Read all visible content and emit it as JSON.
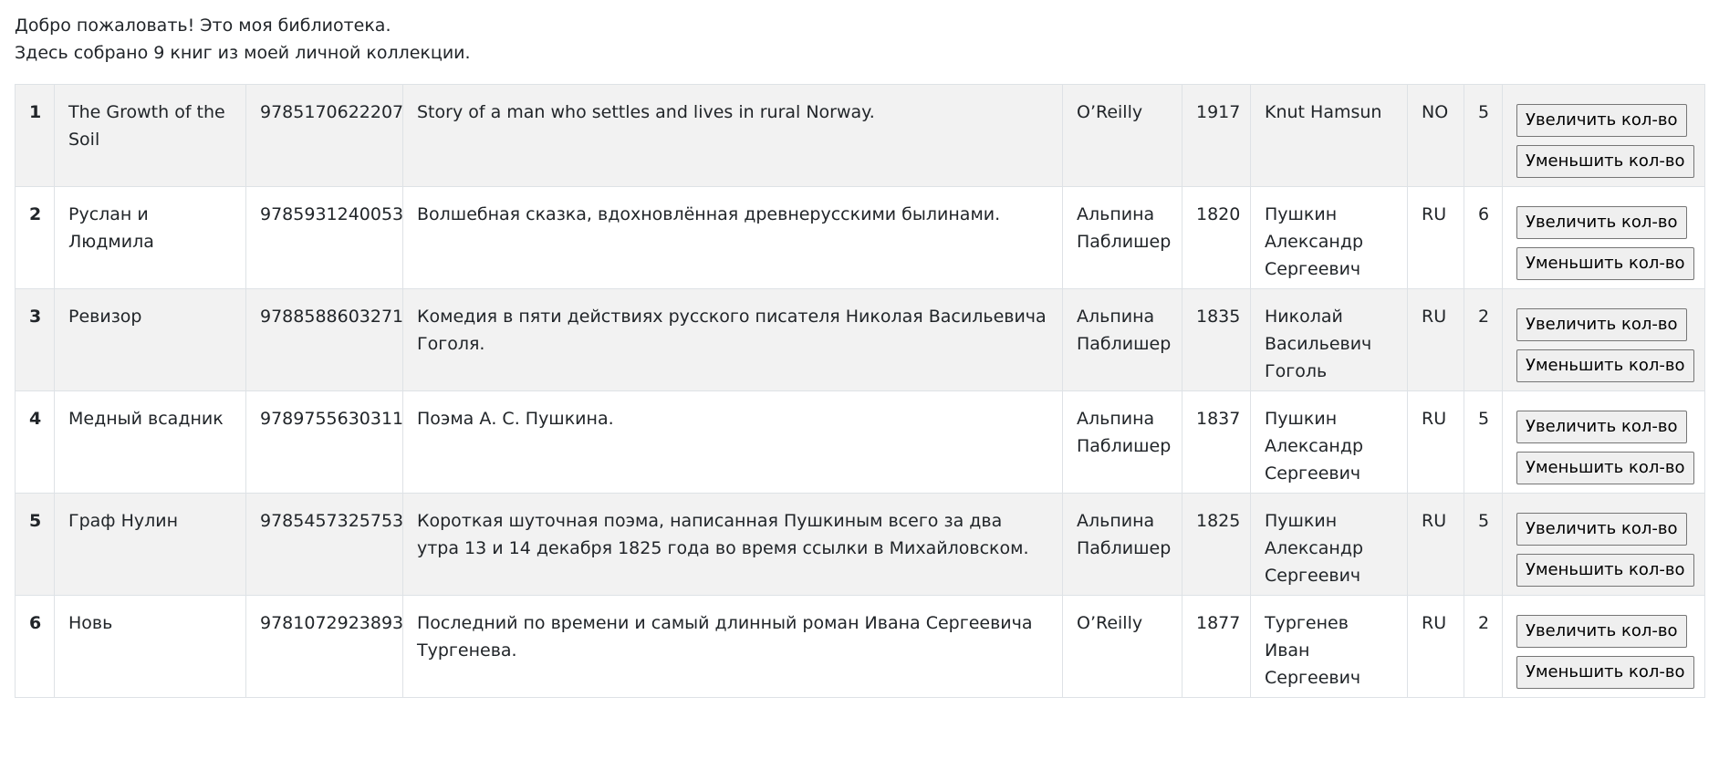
{
  "intro": {
    "line1": "Добро пожаловать! Это моя библиотека.",
    "line2": "Здесь собрано 9 книг из моей личной коллекции."
  },
  "buttons": {
    "increase": "Увеличить кол-во",
    "decrease": "Уменьшить кол-во"
  },
  "books": [
    {
      "num": "1",
      "title": "The Growth of the Soil",
      "isbn": "9785170622207",
      "description": "Story of a man who settles and lives in rural Norway.",
      "publisher": "O’Reilly",
      "year": "1917",
      "author": "Knut Hamsun",
      "lang": "NO",
      "qty": "5"
    },
    {
      "num": "2",
      "title": "Руслан и Людмила",
      "isbn": "9785931240053",
      "description": "Волшебная сказка, вдохновлённая древнерусскими былинами.",
      "publisher": "Альпина Паблишер",
      "year": "1820",
      "author": "Пушкин Александр Сергеевич",
      "lang": "RU",
      "qty": "6"
    },
    {
      "num": "3",
      "title": "Ревизор",
      "isbn": "9788588603271",
      "description": "Комедия в пяти действиях русского писателя Николая Васильевича Гоголя.",
      "publisher": "Альпина Паблишер",
      "year": "1835",
      "author": "Николай Васильевич Гоголь",
      "lang": "RU",
      "qty": "2"
    },
    {
      "num": "4",
      "title": "Медный всадник",
      "isbn": "9789755630311",
      "description": "Поэма А. С. Пушкина.",
      "publisher": "Альпина Паблишер",
      "year": "1837",
      "author": "Пушкин Александр Сергеевич",
      "lang": "RU",
      "qty": "5"
    },
    {
      "num": "5",
      "title": "Граф Нулин",
      "isbn": "9785457325753",
      "description": "Короткая шуточная поэма, написанная Пушкиным всего за два утра 13 и 14 декабря 1825 года во время ссылки в Михайловском.",
      "publisher": "Альпина Паблишер",
      "year": "1825",
      "author": "Пушкин Александр Сергеевич",
      "lang": "RU",
      "qty": "5"
    },
    {
      "num": "6",
      "title": "Новь",
      "isbn": "9781072923893",
      "description": "Последний по времени и самый длинный роман Ивана Сергеевича Тургенева.",
      "publisher": "O’Reilly",
      "year": "1877",
      "author": "Тургенев Иван Сергеевич",
      "lang": "RU",
      "qty": "2"
    }
  ]
}
